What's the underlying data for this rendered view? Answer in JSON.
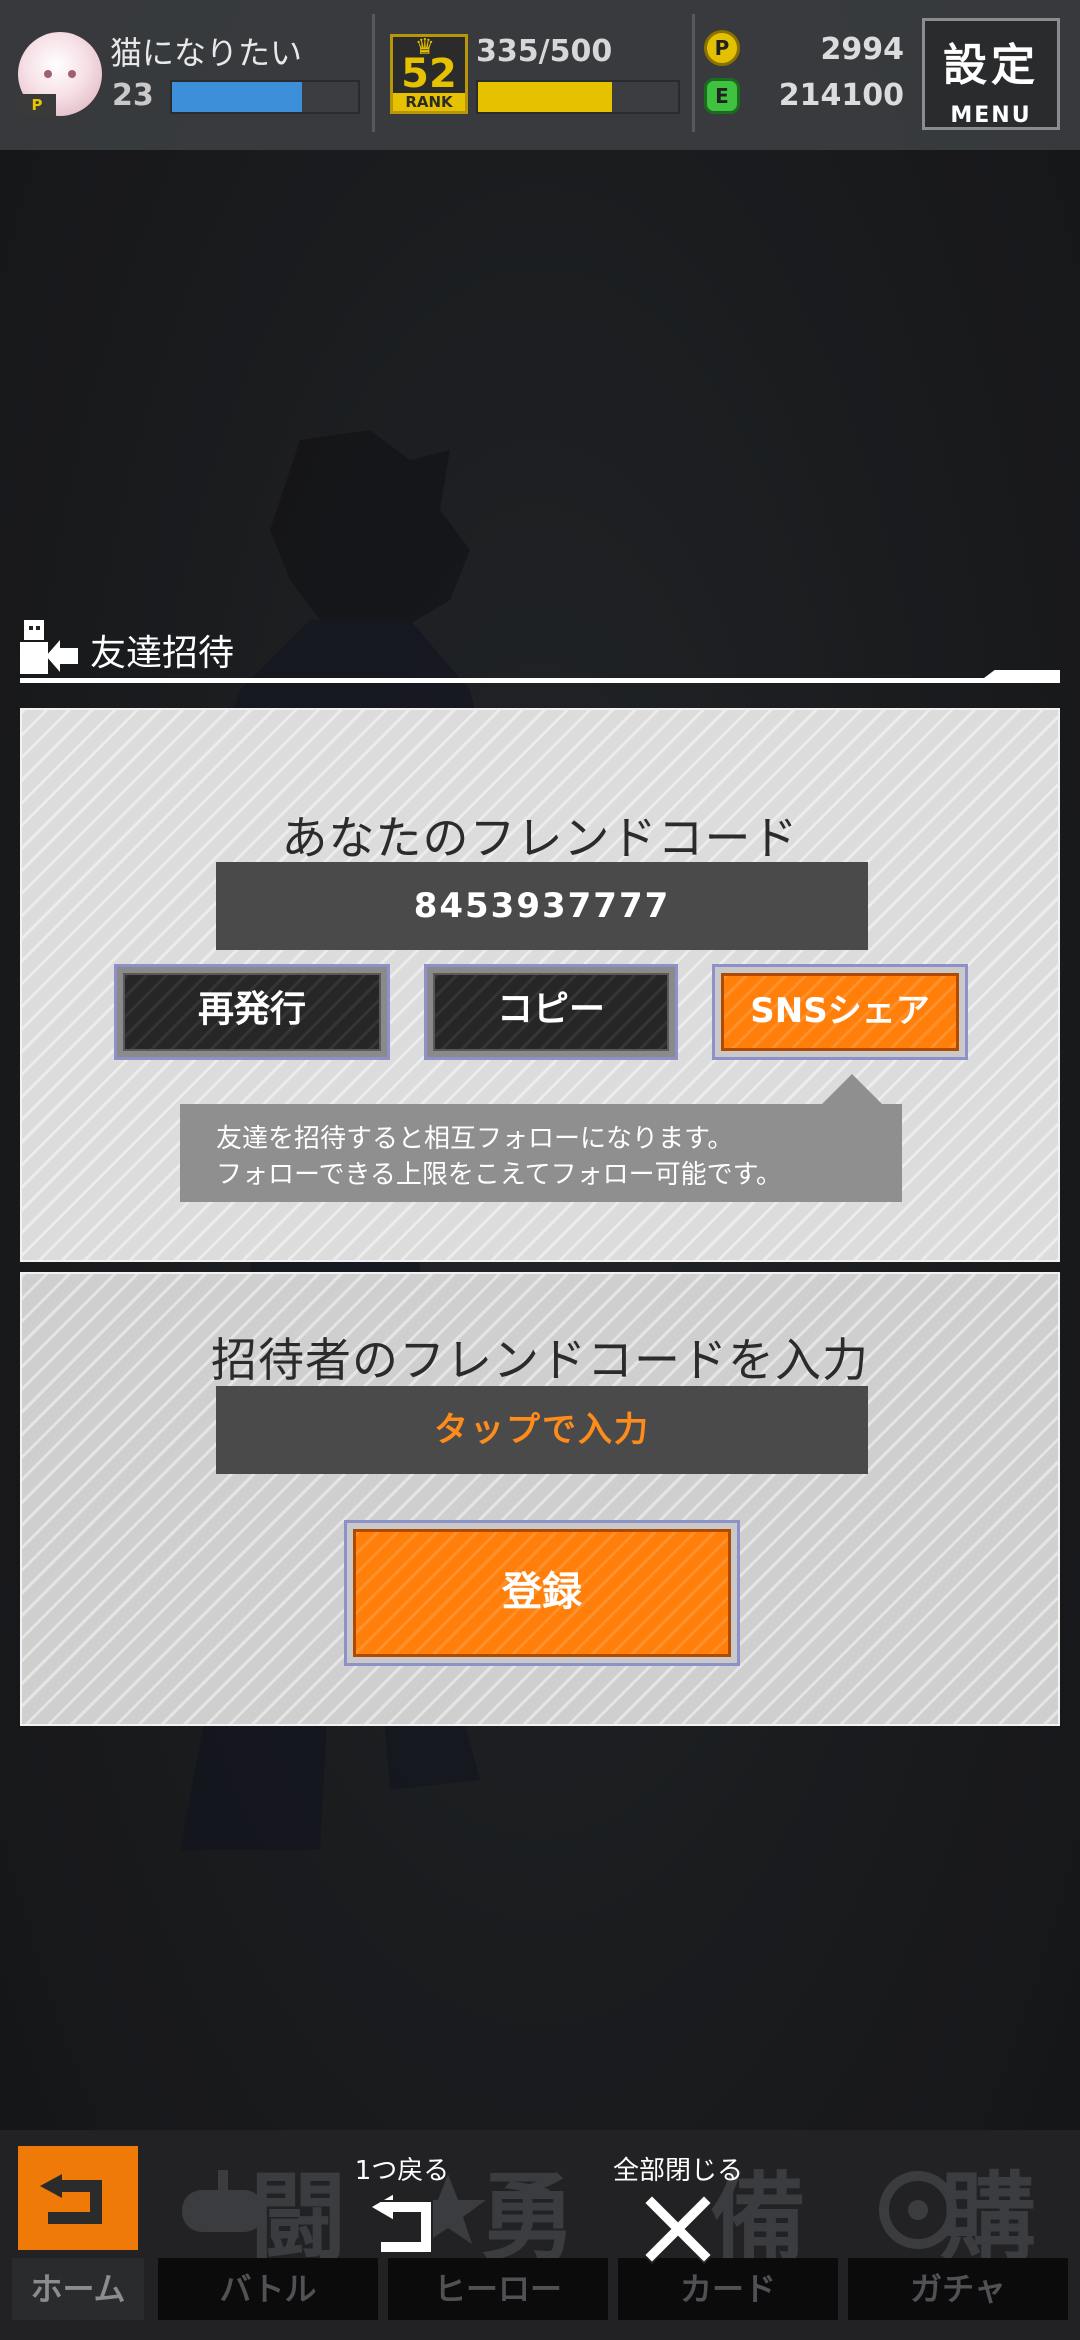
{
  "status_bar": {
    "player_name": "猫になりたい",
    "player_level": "23",
    "level_progress": 0.7,
    "rank_number": "52",
    "rank_label": "RANK",
    "rank_exp": "335/500",
    "rank_progress": 0.67,
    "gold_coins": "2994",
    "green_coins": "214100",
    "settings_label": "設定",
    "menu_label": "MENU"
  },
  "panel": {
    "title": "友達招待",
    "my_code_heading": "あなたのフレンドコード",
    "friend_code": "8453937777",
    "buttons": {
      "reissue": "再発行",
      "copy": "コピー",
      "sns_share": "SNSシェア"
    },
    "tooltip_line1": "友達を招待すると相互フォローになります。",
    "tooltip_line2": "フォローできる上限をこえてフォロー可能です。",
    "enter_code_heading": "招待者のフレンドコードを入力",
    "code_input_placeholder": "タップで入力",
    "register_button": "登録"
  },
  "bottom_nav": {
    "items": [
      {
        "label": "ホーム",
        "glyph": ""
      },
      {
        "label": "バトル",
        "glyph": "闘"
      },
      {
        "label": "ヒーロー",
        "glyph": "勇"
      },
      {
        "label": "カード",
        "glyph": "備"
      },
      {
        "label": "ガチャ",
        "glyph": "購"
      }
    ],
    "back_label": "1つ戻る",
    "close_all_label": "全部閉じる"
  },
  "colors": {
    "accent_orange": "#ff7f0a",
    "level_bar": "#3c8fd8",
    "rank_bar": "#e6c100"
  }
}
